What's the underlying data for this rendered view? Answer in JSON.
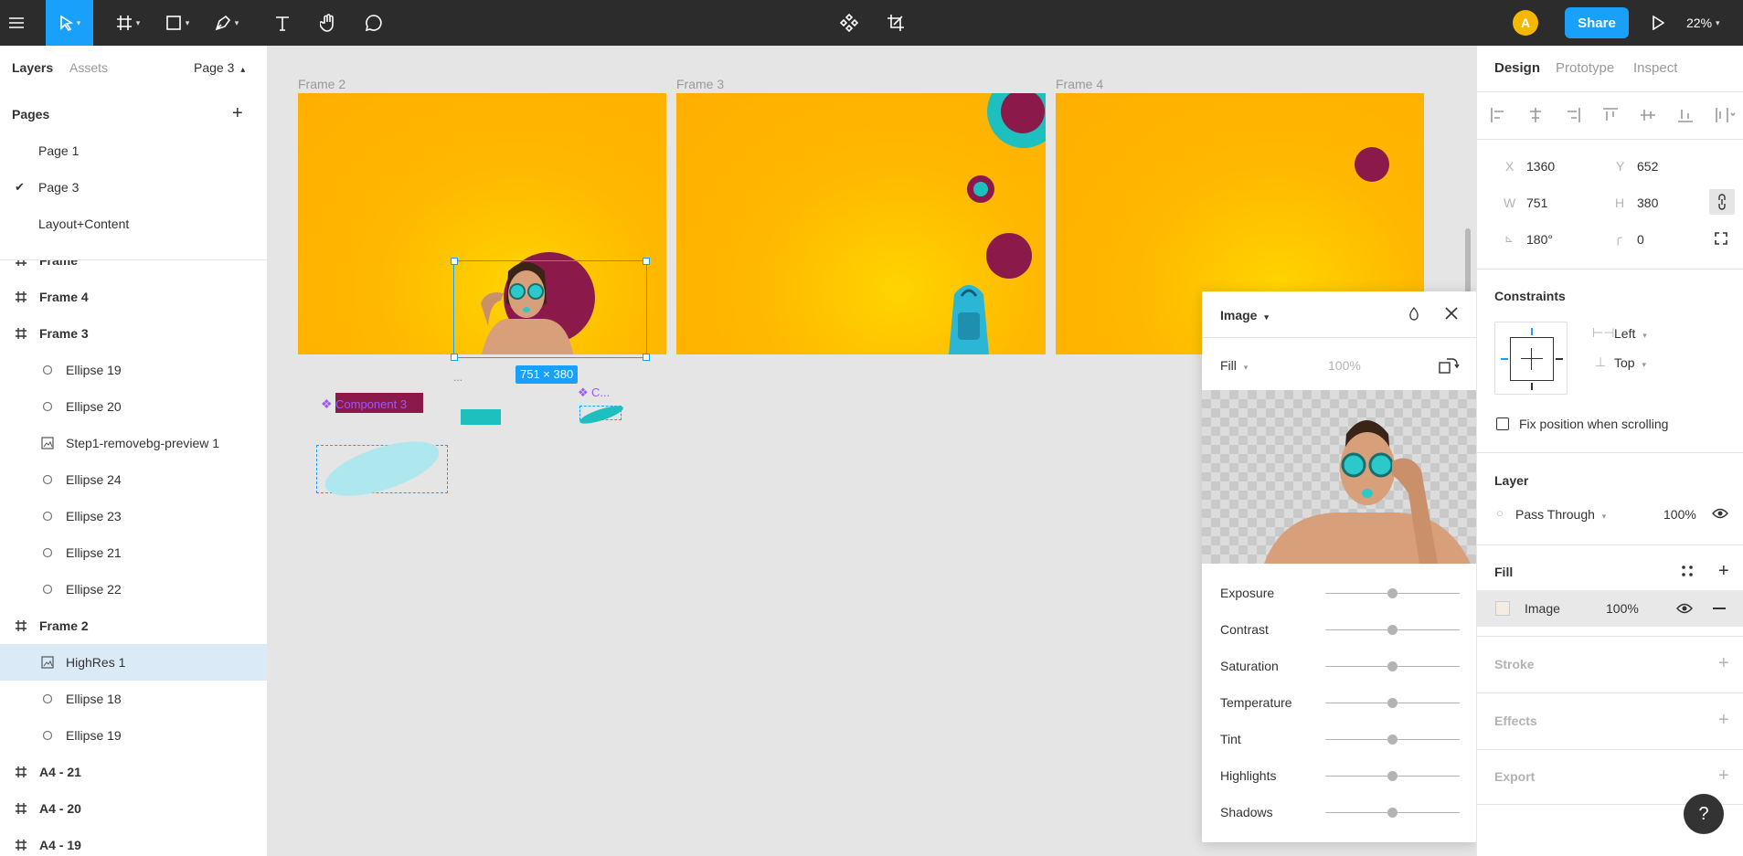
{
  "toolbar": {
    "avatar_initial": "A",
    "share_label": "Share",
    "zoom_label": "22%"
  },
  "left_panel": {
    "tabs": {
      "layers": "Layers",
      "assets": "Assets"
    },
    "current_page": "Page 3",
    "pages_title": "Pages",
    "pages": [
      {
        "label": "Page 1",
        "checked": false
      },
      {
        "label": "Page 3",
        "checked": true
      },
      {
        "label": "Layout+Content",
        "checked": false
      }
    ],
    "layers": [
      {
        "label": "Frame",
        "kind": "frame"
      },
      {
        "label": "Frame 4",
        "kind": "frame"
      },
      {
        "label": "Frame 3",
        "kind": "frame"
      },
      {
        "label": "Ellipse 19",
        "kind": "ellipse"
      },
      {
        "label": "Ellipse 20",
        "kind": "ellipse"
      },
      {
        "label": "Step1-removebg-preview 1",
        "kind": "image"
      },
      {
        "label": "Ellipse 24",
        "kind": "ellipse"
      },
      {
        "label": "Ellipse 23",
        "kind": "ellipse"
      },
      {
        "label": "Ellipse 21",
        "kind": "ellipse"
      },
      {
        "label": "Ellipse 22",
        "kind": "ellipse"
      },
      {
        "label": "Frame 2",
        "kind": "frame"
      },
      {
        "label": "HighRes 1",
        "kind": "image",
        "selected": true
      },
      {
        "label": "Ellipse 18",
        "kind": "ellipse"
      },
      {
        "label": "Ellipse 19",
        "kind": "ellipse"
      },
      {
        "label": "A4 - 21",
        "kind": "frame"
      },
      {
        "label": "A4 - 20",
        "kind": "frame"
      },
      {
        "label": "A4 - 19",
        "kind": "frame"
      }
    ]
  },
  "canvas": {
    "frames": [
      {
        "label": "Frame 2"
      },
      {
        "label": "Frame 3"
      },
      {
        "label": "Frame 4"
      }
    ],
    "selection_size": "751 × 380",
    "component_label": "Component 3",
    "component_short": "C...",
    "ellipsis": "...",
    "colors": {
      "frame_bg": "#ffb300",
      "maroon": "#8b1a4a",
      "teal": "#1dbfbf",
      "selection": "#18a0fb"
    }
  },
  "image_popup": {
    "title": "Image",
    "fill_mode": "Fill",
    "fill_opacity": "100%",
    "adjustments": [
      {
        "label": "Exposure",
        "value": 0.5
      },
      {
        "label": "Contrast",
        "value": 0.5
      },
      {
        "label": "Saturation",
        "value": 0.5
      },
      {
        "label": "Temperature",
        "value": 0.5
      },
      {
        "label": "Tint",
        "value": 0.5
      },
      {
        "label": "Highlights",
        "value": 0.5
      },
      {
        "label": "Shadows",
        "value": 0.5
      }
    ]
  },
  "right_panel": {
    "tabs": {
      "design": "Design",
      "prototype": "Prototype",
      "inspect": "Inspect"
    },
    "props": {
      "x_label": "X",
      "x_value": "1360",
      "y_label": "Y",
      "y_value": "652",
      "w_label": "W",
      "w_value": "751",
      "h_label": "H",
      "h_value": "380",
      "rotation": "180°",
      "radius": "0"
    },
    "constraints": {
      "title": "Constraints",
      "horizontal": "Left",
      "vertical": "Top",
      "fix_position_label": "Fix position when scrolling"
    },
    "layer": {
      "title": "Layer",
      "blend": "Pass Through",
      "opacity": "100%"
    },
    "fill": {
      "title": "Fill",
      "type": "Image",
      "opacity": "100%"
    },
    "stroke_title": "Stroke",
    "effects_title": "Effects",
    "export_title": "Export",
    "help": "?"
  }
}
